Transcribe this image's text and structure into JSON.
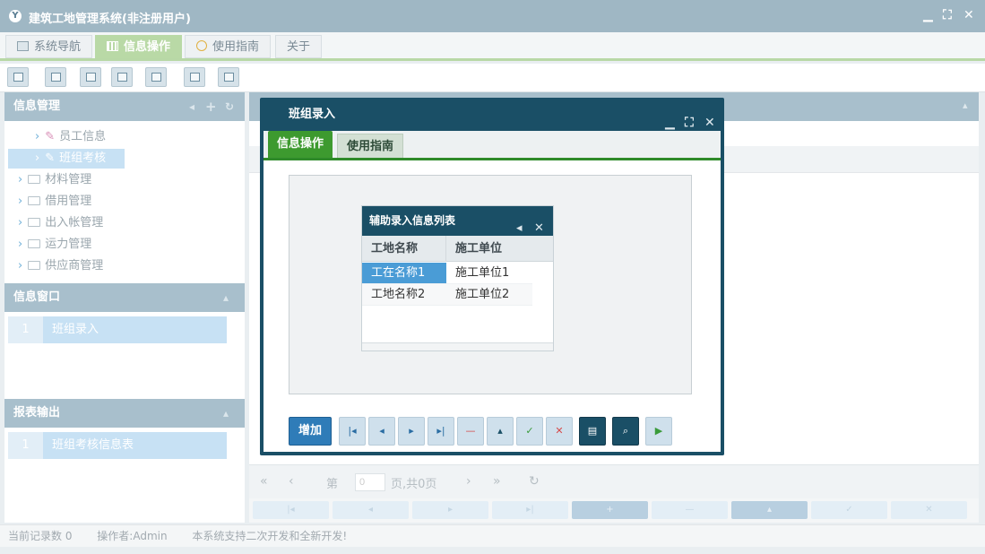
{
  "app": {
    "title": "建筑工地管理系统(非注册用户)"
  },
  "main_tabs": [
    {
      "label": "系统导航"
    },
    {
      "label": "信息操作"
    },
    {
      "label": "使用指南"
    },
    {
      "label": "关于"
    }
  ],
  "left": {
    "info_mgmt": {
      "title": "信息管理",
      "items": [
        {
          "label": "员工信息"
        },
        {
          "label": "班组考核"
        },
        {
          "label": "材料管理"
        },
        {
          "label": "借用管理"
        },
        {
          "label": "出入帐管理"
        },
        {
          "label": "运力管理"
        },
        {
          "label": "供应商管理"
        }
      ]
    },
    "info_window": {
      "title": "信息窗口",
      "rows": [
        {
          "num": "1",
          "label": "班组录入"
        }
      ]
    },
    "report": {
      "title": "报表输出",
      "rows": [
        {
          "num": "1",
          "label": "班组考核信息表"
        }
      ]
    }
  },
  "pager": {
    "page_prefix": "第",
    "page_value": "0",
    "page_suffix": "页,共0页"
  },
  "status": {
    "records": "当前记录数 0",
    "operator": "操作者:Admin",
    "note": "本系统支持二次开发和全新开发!"
  },
  "modal": {
    "title": "班组录入",
    "tabs": [
      {
        "label": "信息操作"
      },
      {
        "label": "使用指南"
      }
    ],
    "subpanel": {
      "title": "辅助录入信息列表",
      "columns": [
        "工地名称",
        "施工单位"
      ],
      "rows": [
        [
          "工在名称1",
          "施工单位1"
        ],
        [
          "工地名称2",
          "施工单位2"
        ]
      ]
    },
    "add_label": "增加"
  }
}
